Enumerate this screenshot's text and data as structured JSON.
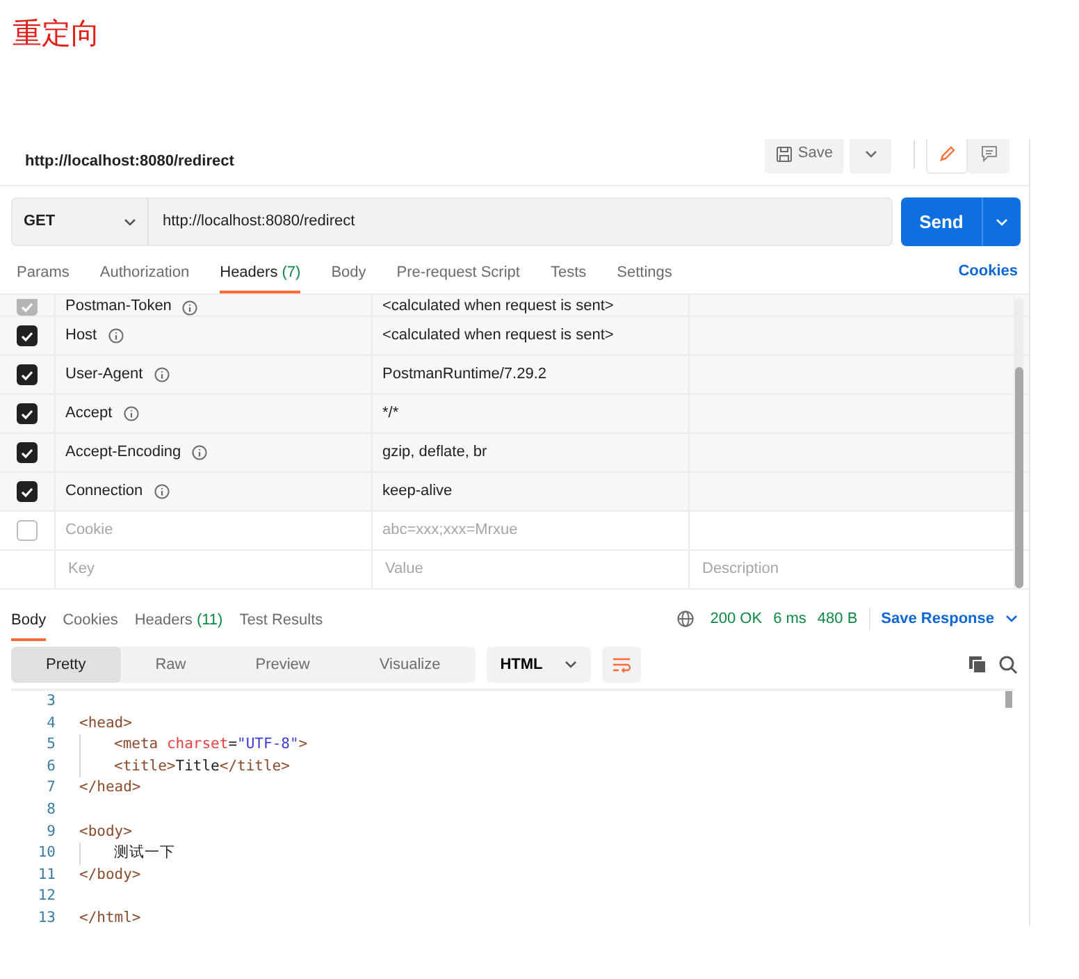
{
  "article_heading": "重定向",
  "request": {
    "name": "http://localhost:8080/redirect",
    "save_label": "Save",
    "method": "GET",
    "url": "http://localhost:8080/redirect",
    "send_label": "Send"
  },
  "request_tabs": [
    {
      "label": "Params",
      "selected": false
    },
    {
      "label": "Authorization",
      "selected": false
    },
    {
      "label": "Headers",
      "count": "(7)",
      "selected": true
    },
    {
      "label": "Body",
      "selected": false
    },
    {
      "label": "Pre-request Script",
      "selected": false
    },
    {
      "label": "Tests",
      "selected": false
    },
    {
      "label": "Settings",
      "selected": false
    }
  ],
  "cookies_link": "Cookies",
  "headers": [
    {
      "key": "Postman-Token",
      "value": "<calculated when request is sent>",
      "checked": true,
      "disabled": true,
      "info": true
    },
    {
      "key": "Host",
      "value": "<calculated when request is sent>",
      "checked": true,
      "disabled": false,
      "info": true
    },
    {
      "key": "User-Agent",
      "value": "PostmanRuntime/7.29.2",
      "checked": true,
      "disabled": false,
      "info": true
    },
    {
      "key": "Accept",
      "value": "*/*",
      "checked": true,
      "disabled": false,
      "info": true
    },
    {
      "key": "Accept-Encoding",
      "value": "gzip, deflate, br",
      "checked": true,
      "disabled": false,
      "info": true
    },
    {
      "key": "Connection",
      "value": "keep-alive",
      "checked": true,
      "disabled": false,
      "info": true
    },
    {
      "key": "Cookie",
      "value": "abc=xxx;xxx=Mrxue",
      "checked": false,
      "disabled": false,
      "info": false
    }
  ],
  "new_header": {
    "key_placeholder": "Key",
    "value_placeholder": "Value",
    "description_placeholder": "Description"
  },
  "response_tabs": [
    {
      "label": "Body",
      "selected": true
    },
    {
      "label": "Cookies",
      "selected": false
    },
    {
      "label": "Headers",
      "count": "(11)",
      "selected": false
    },
    {
      "label": "Test Results",
      "selected": false
    }
  ],
  "response_status": {
    "status": "200 OK",
    "time": "6 ms",
    "size": "480 B",
    "save_label": "Save Response"
  },
  "view_modes": [
    {
      "label": "Pretty",
      "selected": true
    },
    {
      "label": "Raw",
      "selected": false
    },
    {
      "label": "Preview",
      "selected": false
    },
    {
      "label": "Visualize",
      "selected": false
    }
  ],
  "format": "HTML",
  "code_lines": [
    {
      "number": "3",
      "indented": false
    },
    {
      "number": "4",
      "indented": false,
      "tokens": [
        {
          "kind": "tag",
          "text": "<head>"
        }
      ]
    },
    {
      "number": "5",
      "indented": true,
      "tokens": [
        {
          "kind": "tag",
          "text": "<meta "
        },
        {
          "kind": "attr",
          "text": "charset"
        },
        {
          "kind": "plain",
          "text": "="
        },
        {
          "kind": "string",
          "text": "\"UTF-8\""
        },
        {
          "kind": "tag",
          "text": ">"
        }
      ]
    },
    {
      "number": "6",
      "indented": true,
      "tokens": [
        {
          "kind": "tag",
          "text": "<title>"
        },
        {
          "kind": "plain",
          "text": "Title"
        },
        {
          "kind": "tag",
          "text": "</title>"
        }
      ]
    },
    {
      "number": "7",
      "indented": false,
      "tokens": [
        {
          "kind": "tag",
          "text": "</head>"
        }
      ]
    },
    {
      "number": "8",
      "indented": false
    },
    {
      "number": "9",
      "indented": false,
      "tokens": [
        {
          "kind": "tag",
          "text": "<body>"
        }
      ]
    },
    {
      "number": "10",
      "indented": true,
      "tokens": [
        {
          "kind": "plain",
          "text": "测试一下"
        }
      ]
    },
    {
      "number": "11",
      "indented": false,
      "tokens": [
        {
          "kind": "tag",
          "text": "</body>"
        }
      ]
    },
    {
      "number": "12",
      "indented": false
    },
    {
      "number": "13",
      "indented": false,
      "tokens": [
        {
          "kind": "tag",
          "text": "</html>"
        }
      ]
    }
  ]
}
